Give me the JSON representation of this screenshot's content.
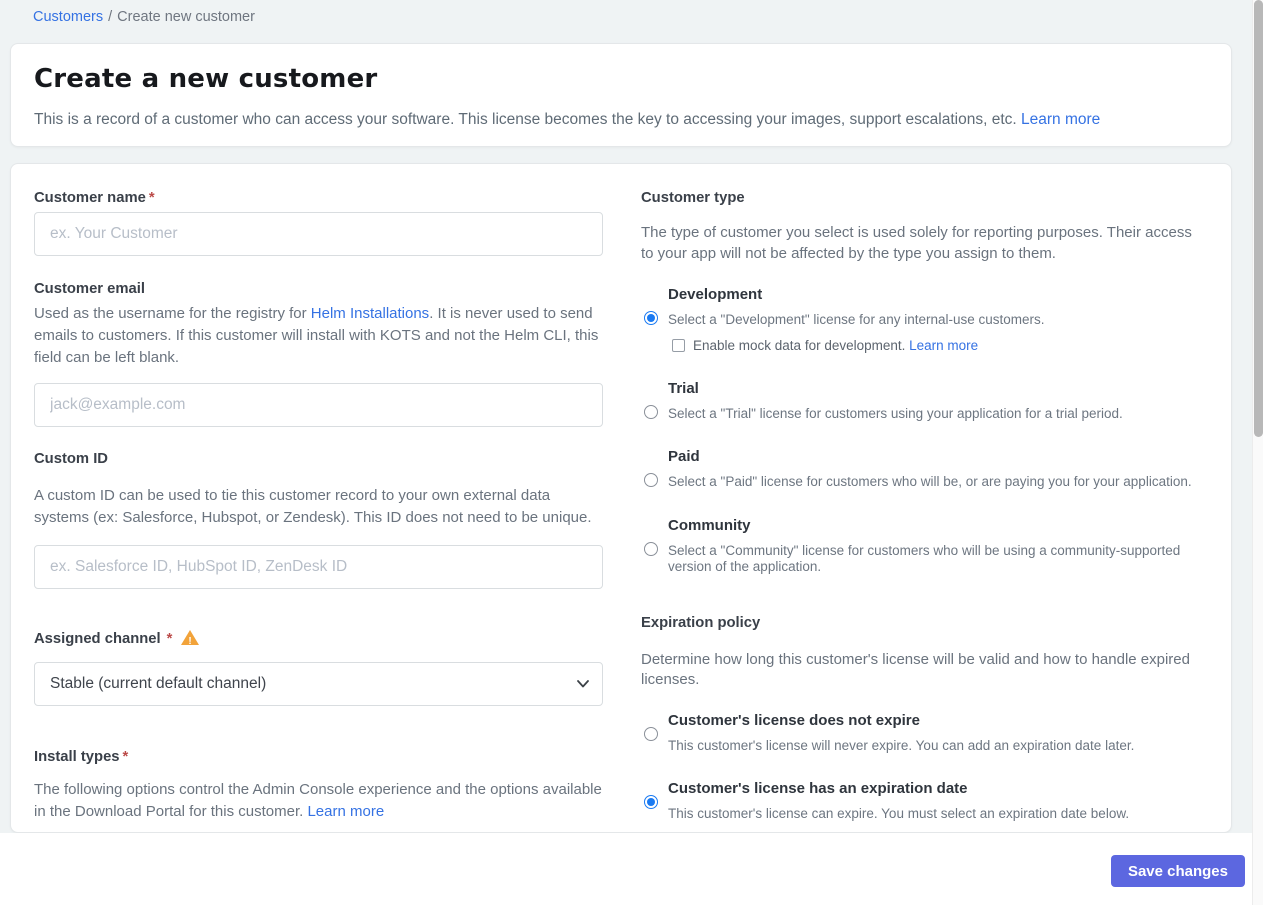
{
  "breadcrumb": {
    "link": "Customers",
    "separator": "/",
    "current": "Create new customer"
  },
  "header": {
    "title": "Create a new customer",
    "description": "This is a record of a customer who can access your software. This license becomes the key to accessing your images, support escalations, etc.",
    "learn_more": "Learn more"
  },
  "form": {
    "customer_name": {
      "label": "Customer name",
      "required": "*",
      "placeholder": "ex. Your Customer",
      "value": ""
    },
    "customer_email": {
      "label": "Customer email",
      "description_before": "Used as the username for the registry for ",
      "link": "Helm Installations",
      "description_after": ". It is never used to send emails to customers. If this customer will install with KOTS and not the Helm CLI, this field can be left blank.",
      "placeholder": "jack@example.com",
      "value": ""
    },
    "custom_id": {
      "label": "Custom ID",
      "description": "A custom ID can be used to tie this customer record to your own external data systems (ex: Salesforce, Hubspot, or Zendesk). This ID does not need to be unique.",
      "placeholder": "ex. Salesforce ID, HubSpot ID, ZenDesk ID",
      "value": ""
    },
    "assigned_channel": {
      "label": "Assigned channel",
      "required": "*",
      "selected_option": "Stable (current default channel)"
    },
    "install_types": {
      "label": "Install types",
      "required": "*",
      "description": "The following options control the Admin Console experience and the options available in the Download Portal for this customer.",
      "learn_more": "Learn more"
    }
  },
  "customer_type": {
    "heading": "Customer type",
    "description": "The type of customer you select is used solely for reporting purposes. Their access to your app will not be affected by the type you assign to them.",
    "options": [
      {
        "label": "Development",
        "description": "Select a \"Development\" license for any internal-use customers.",
        "selected": true,
        "checkbox_label": "Enable mock data for development.",
        "checkbox_learn_more": "Learn more",
        "checkbox_checked": false
      },
      {
        "label": "Trial",
        "description": "Select a \"Trial\" license for customers using your application for a trial period.",
        "selected": false
      },
      {
        "label": "Paid",
        "description": "Select a \"Paid\" license for customers who will be, or are paying you for your application.",
        "selected": false
      },
      {
        "label": "Community",
        "description": "Select a \"Community\" license for customers who will be using a community-supported version of the application.",
        "selected": false
      }
    ]
  },
  "expiration_policy": {
    "heading": "Expiration policy",
    "description": "Determine how long this customer's license will be valid and how to handle expired licenses.",
    "options": [
      {
        "label": "Customer's license does not expire",
        "description": "This customer's license will never expire. You can add an expiration date later.",
        "selected": false
      },
      {
        "label": "Customer's license has an expiration date",
        "description": "This customer's license can expire. You must select an expiration date below.",
        "selected": true
      }
    ]
  },
  "footer": {
    "save_label": "Save changes"
  },
  "colors": {
    "link_blue": "#3572e3",
    "radio_blue": "#1a7af2",
    "button_indigo": "#5c67e0",
    "warning_orange": "#f2a33a",
    "required_red": "#bb4a48",
    "page_background": "#eff3f4"
  }
}
